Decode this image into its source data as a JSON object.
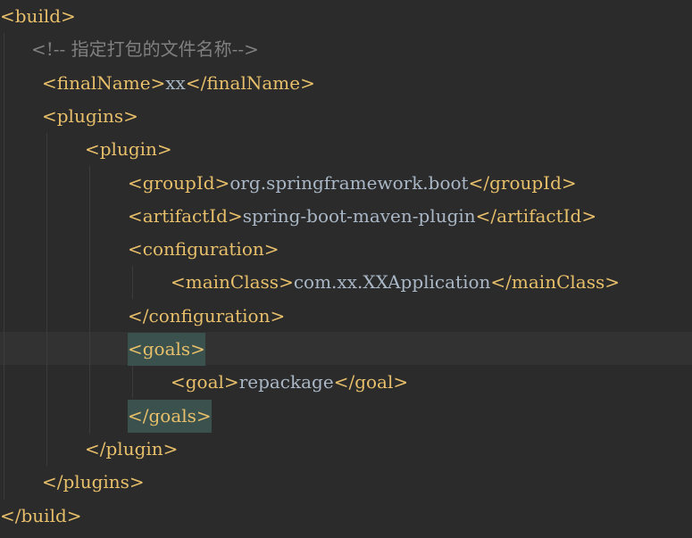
{
  "editor": {
    "lines": [
      {
        "indent": 0,
        "parts": [
          {
            "t": "tag",
            "v": "<build>"
          }
        ]
      },
      {
        "indent": 35,
        "parts": [
          {
            "t": "comment",
            "v": "<!-- 指定打包的文件名称-->"
          }
        ]
      },
      {
        "indent": 47,
        "parts": [
          {
            "t": "tag",
            "v": "<finalName>"
          },
          {
            "t": "txt",
            "v": "xx"
          },
          {
            "t": "tag",
            "v": "</finalName>"
          }
        ]
      },
      {
        "indent": 47,
        "parts": [
          {
            "t": "tag",
            "v": "<plugins>"
          }
        ]
      },
      {
        "indent": 95,
        "parts": [
          {
            "t": "tag",
            "v": "<plugin>"
          }
        ]
      },
      {
        "indent": 143,
        "parts": [
          {
            "t": "tag",
            "v": "<groupId>"
          },
          {
            "t": "txt",
            "v": "org.springframework.boot"
          },
          {
            "t": "tag",
            "v": "</groupId>"
          }
        ]
      },
      {
        "indent": 143,
        "parts": [
          {
            "t": "tag",
            "v": "<artifactId>"
          },
          {
            "t": "txt",
            "v": "spring-boot-maven-plugin"
          },
          {
            "t": "tag",
            "v": "</artifactId>"
          }
        ]
      },
      {
        "indent": 143,
        "parts": [
          {
            "t": "tag",
            "v": "<configuration>"
          }
        ]
      },
      {
        "indent": 191,
        "parts": [
          {
            "t": "tag",
            "v": "<mainClass>"
          },
          {
            "t": "txt",
            "v": "com.xx.XXApplication"
          },
          {
            "t": "tag",
            "v": "</mainClass>"
          }
        ]
      },
      {
        "indent": 143,
        "parts": [
          {
            "t": "tag",
            "v": "</configuration>"
          }
        ]
      },
      {
        "indent": 143,
        "parts": [
          {
            "t": "tag match",
            "v": "<goals>"
          }
        ]
      },
      {
        "indent": 191,
        "parts": [
          {
            "t": "tag",
            "v": "<goal>"
          },
          {
            "t": "txt",
            "v": "repackage"
          },
          {
            "t": "tag",
            "v": "</goal>"
          }
        ]
      },
      {
        "indent": 143,
        "parts": [
          {
            "t": "tag match",
            "v": "</goals>"
          }
        ]
      },
      {
        "indent": 95,
        "parts": [
          {
            "t": "tag",
            "v": "</plugin>"
          }
        ]
      },
      {
        "indent": 47,
        "parts": [
          {
            "t": "tag",
            "v": "</plugins>"
          }
        ]
      },
      {
        "indent": 0,
        "parts": [
          {
            "t": "tag",
            "v": "</build>"
          }
        ]
      }
    ]
  }
}
